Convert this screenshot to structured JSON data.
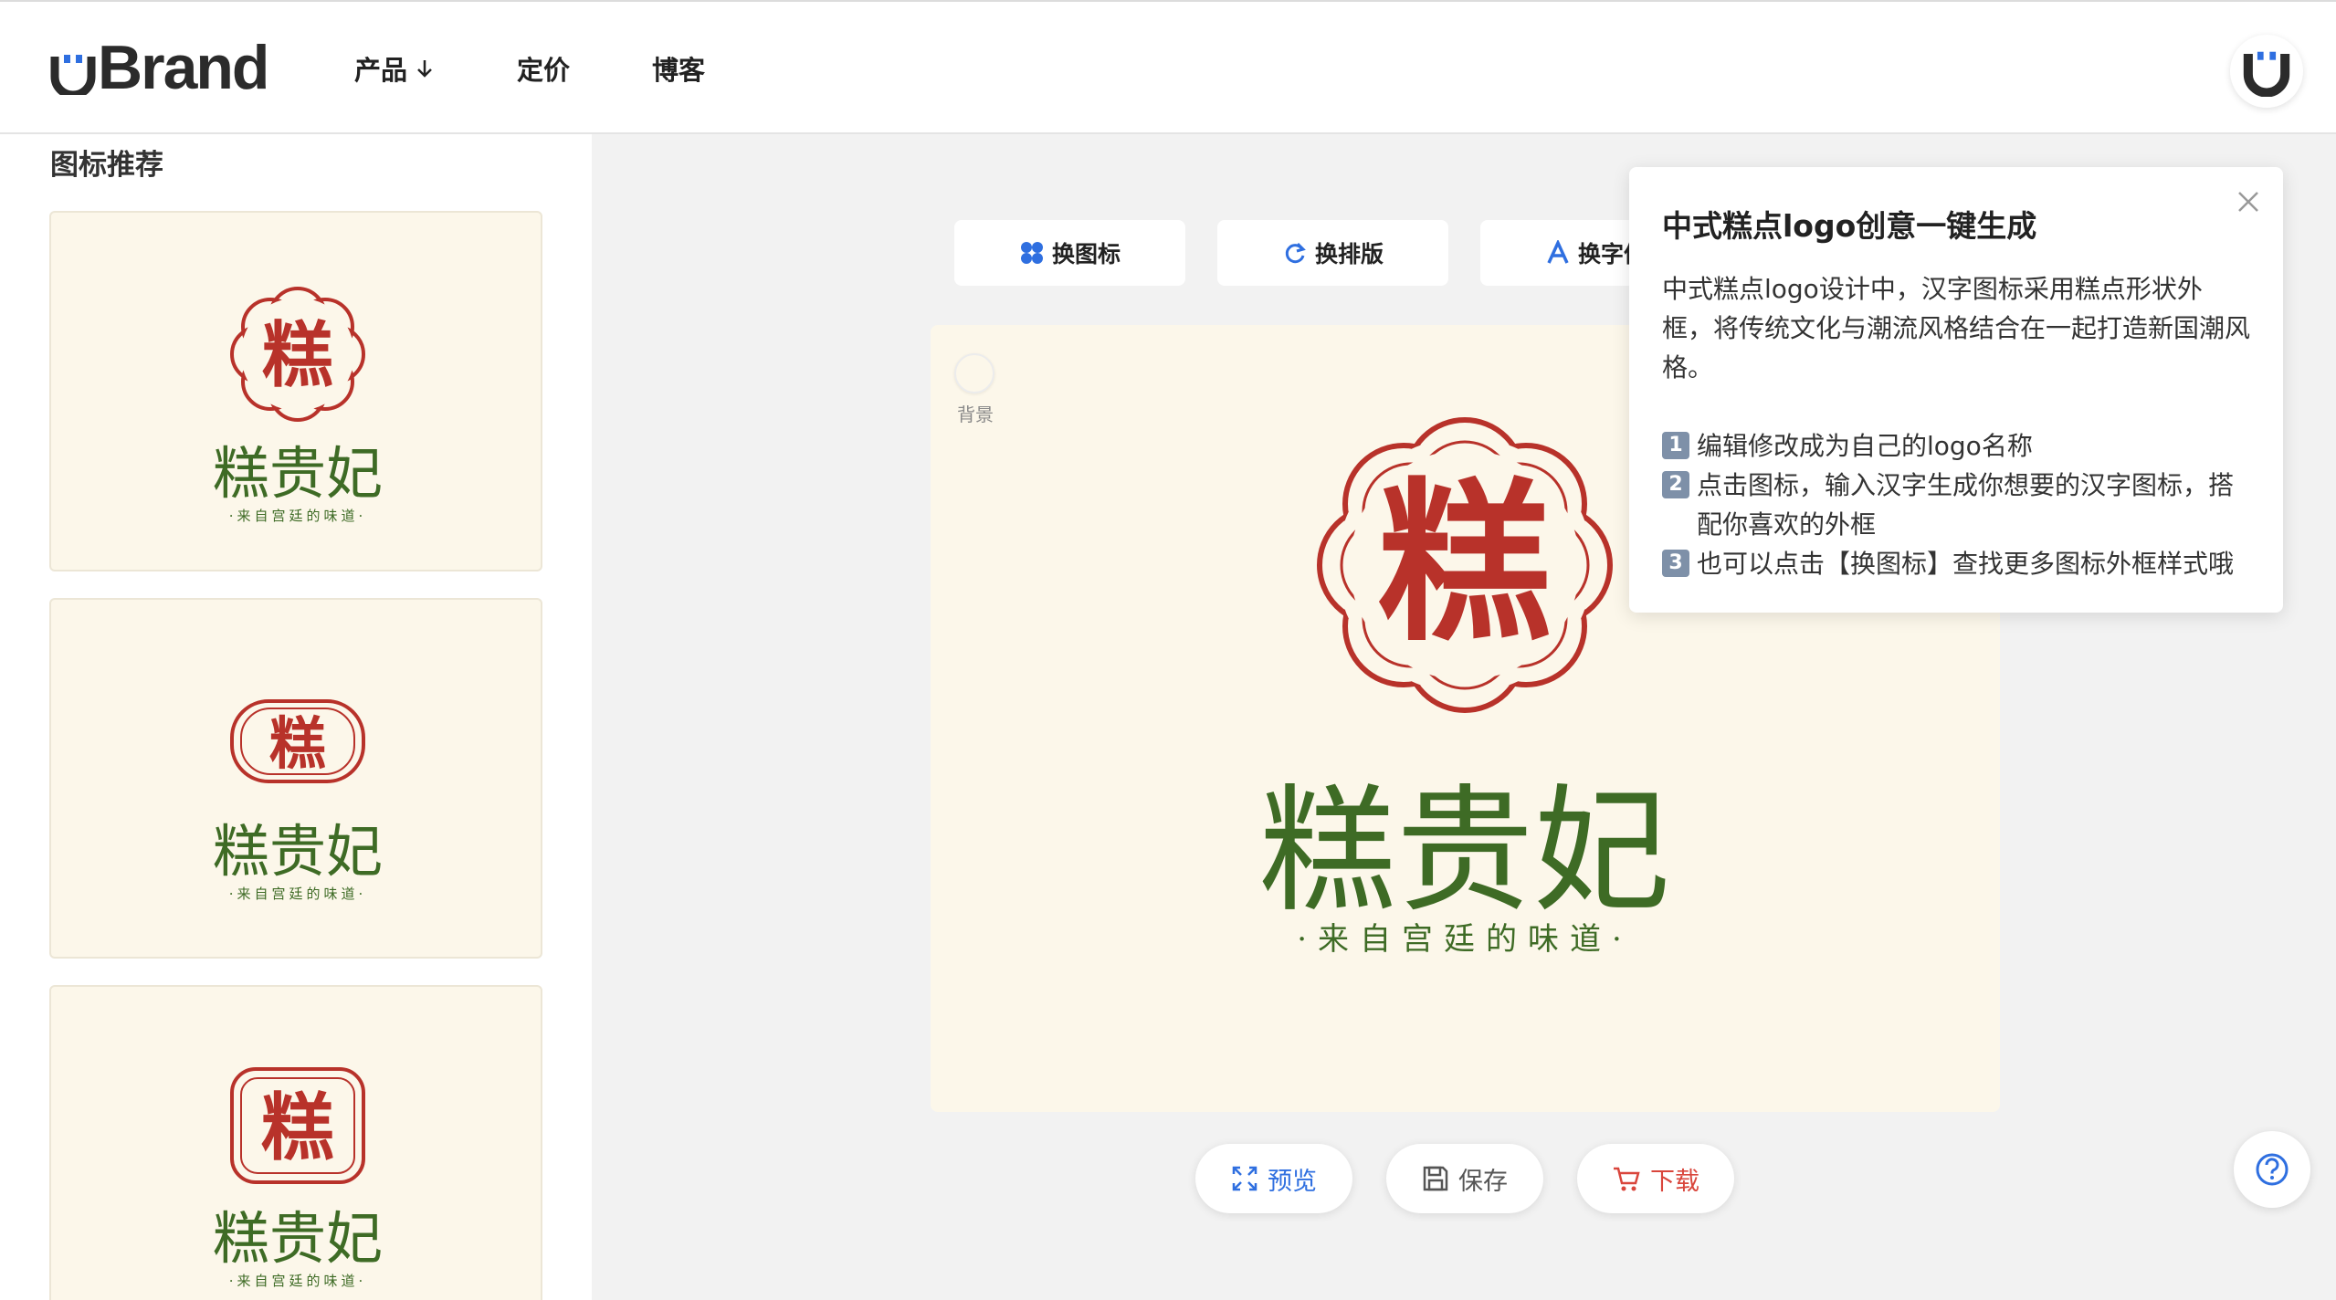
{
  "header": {
    "brand": "Brand",
    "nav": [
      "产品",
      "定价",
      "博客"
    ]
  },
  "sidebar": {
    "title": "图标推荐"
  },
  "logo_design": {
    "icon_char": "糕",
    "name": "糕贵妃",
    "slogan": "·来自宫廷的味道·"
  },
  "toolbar": {
    "change_icon": "换图标",
    "change_layout": "换排版",
    "change_font": "换字体"
  },
  "canvas": {
    "background_label": "背景",
    "background_color": "#fcf7ea"
  },
  "actions": {
    "preview": "预览",
    "save": "保存",
    "download": "下载"
  },
  "tooltip": {
    "title": "中式糕点logo创意一键生成",
    "intro": "中式糕点logo设计中，汉字图标采用糕点形状外框，将传统文化与潮流风格结合在一起打造新国潮风格。",
    "steps": [
      {
        "num": "1",
        "text": "编辑修改成为自己的logo名称"
      },
      {
        "num": "2",
        "text": "点击图标，输入汉字生成你想要的汉字图标，搭配你喜欢的外框"
      },
      {
        "num": "3",
        "text": "也可以点击【换图标】查找更多图标外框样式哦"
      }
    ]
  },
  "colors": {
    "accent_blue": "#2f6fe0",
    "logo_red": "#b8322a",
    "logo_green": "#3e6b25",
    "download_red": "#d9463c",
    "save_gray": "#555555"
  },
  "icons": [
    "chevron-down-icon",
    "user-icon",
    "shapes-icon",
    "refresh-icon",
    "font-icon",
    "fullscreen-icon",
    "save-icon",
    "cart-icon",
    "close-icon",
    "help-icon"
  ]
}
